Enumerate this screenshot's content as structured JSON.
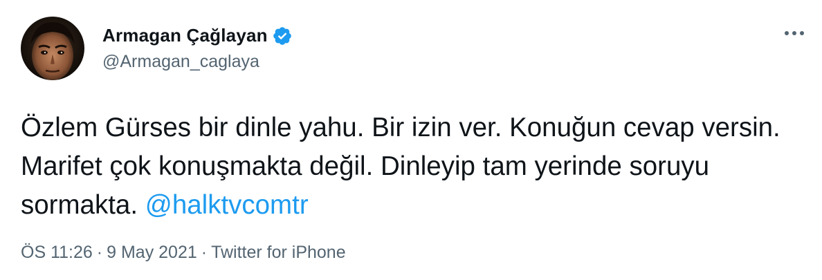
{
  "author": {
    "display_name": "Armagan Çağlayan",
    "handle": "@Armagan_caglaya",
    "verified": true
  },
  "tweet": {
    "text_plain": "Özlem Gürses bir dinle yahu. Bir izin ver. Konuğun cevap versin. Marifet çok konuşmakta değil. Dinleyip tam yerinde soruyu sormakta.",
    "mention": "@halktvcomtr"
  },
  "meta": {
    "time": "ÖS 11:26",
    "separator_1": "·",
    "date": "9 May 2021",
    "separator_2": "·",
    "source": "Twitter for iPhone"
  },
  "icons": {
    "verified": "verified-badge-icon",
    "more": "more-horizontal-icon"
  },
  "colors": {
    "text": "#0f1419",
    "secondary": "#536471",
    "accent": "#1d9bf0"
  }
}
